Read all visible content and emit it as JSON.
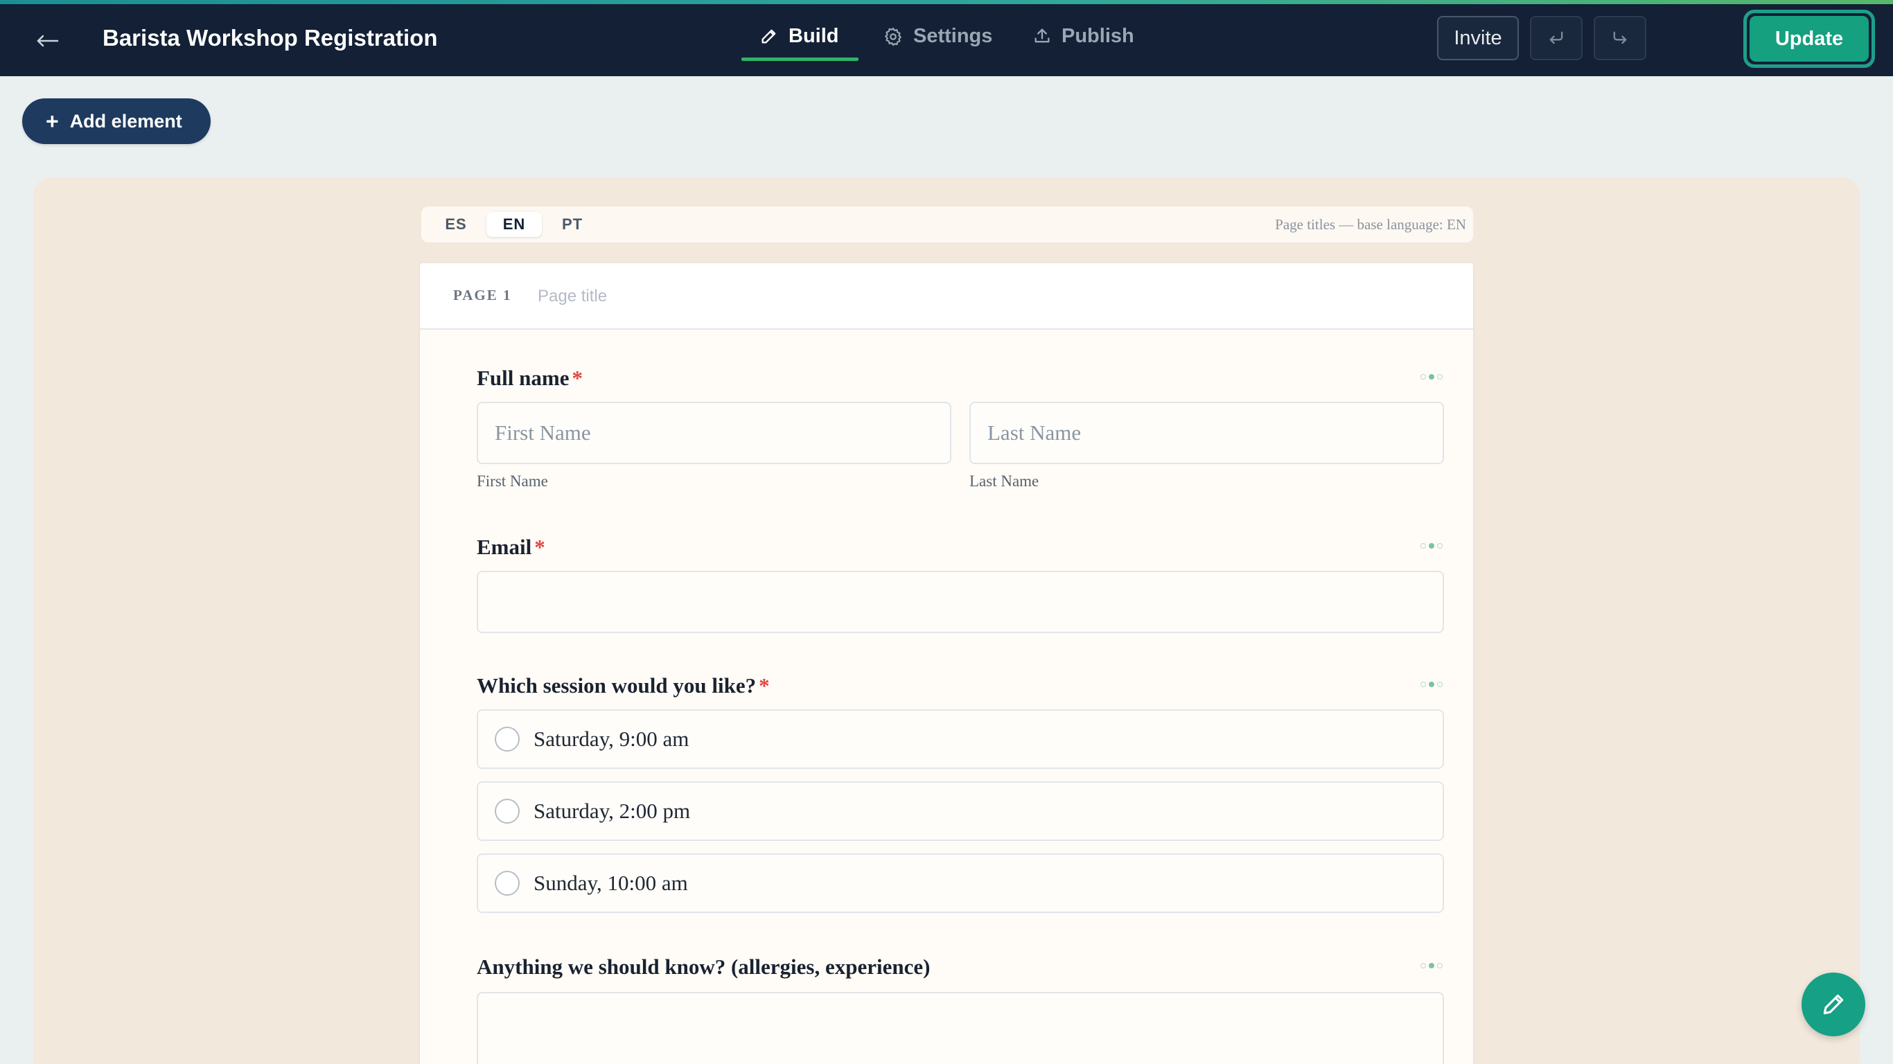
{
  "header": {
    "title": "Barista Workshop Registration",
    "tabs": [
      {
        "label": "Build",
        "icon": "pencil-icon",
        "active": true
      },
      {
        "label": "Settings",
        "icon": "gear-icon",
        "active": false
      },
      {
        "label": "Publish",
        "icon": "upload-icon",
        "active": false
      }
    ],
    "invite_label": "Invite",
    "update_label": "Update"
  },
  "toolbar": {
    "add_element_label": "Add element"
  },
  "language_bar": {
    "languages": [
      {
        "code": "ES",
        "active": false
      },
      {
        "code": "EN",
        "active": true
      },
      {
        "code": "PT",
        "active": false
      }
    ],
    "hint": "Page titles — base language: EN"
  },
  "page": {
    "label": "PAGE 1",
    "title_placeholder": "Page title"
  },
  "questions": {
    "full_name": {
      "label": "Full name",
      "required": "*",
      "first_placeholder": "First Name",
      "last_placeholder": "Last Name",
      "first_sublabel": "First Name",
      "last_sublabel": "Last Name"
    },
    "email": {
      "label": "Email",
      "required": "*"
    },
    "session": {
      "label": "Which session would you like?",
      "required": "*",
      "options": [
        "Saturday, 9:00 am",
        "Saturday, 2:00 pm",
        "Sunday, 10:00 am"
      ]
    },
    "notes": {
      "label": "Anything we should know? (allergies, experience)"
    }
  },
  "colors": {
    "topbar": "#132035",
    "accent_green": "#15a07f",
    "canvas": "#f3e8dc",
    "required": "#e0453c"
  }
}
